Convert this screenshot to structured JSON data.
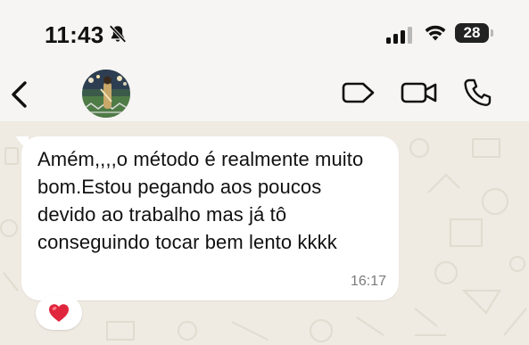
{
  "status_bar": {
    "time": "11:43",
    "battery_level": "28",
    "icons": [
      "bell-slash-icon",
      "cellular-signal-icon",
      "wifi-icon",
      "battery-icon"
    ]
  },
  "header": {
    "back_icon": "chevron-left-icon",
    "contact_avatar": "contact-avatar",
    "actions": [
      "video-call-icon",
      "camera-icon",
      "phone-icon"
    ]
  },
  "chat": {
    "message": {
      "text": "Amém,,,,o método é realmente muito bom.Estou pegando aos poucos devido ao trabalho mas já tô conseguindo tocar bem lento kkkk",
      "time": "16:17",
      "reaction": "heart-emoji-icon"
    }
  },
  "colors": {
    "chat_background": "#efeae2",
    "bubble": "#ffffff",
    "heart": "#e0263c"
  }
}
